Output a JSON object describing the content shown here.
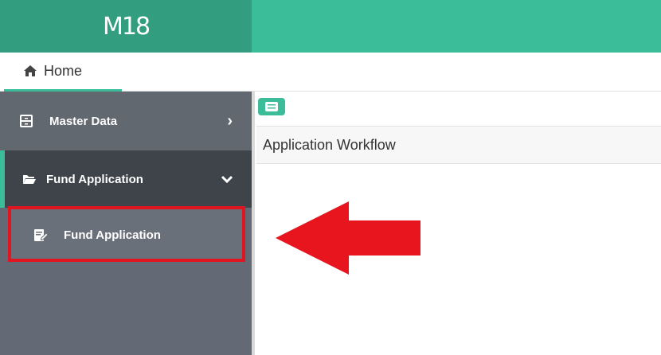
{
  "header": {
    "logo_text": "M18"
  },
  "tabs": {
    "home_label": "Home"
  },
  "sidebar": {
    "items": [
      {
        "label": "Master Data",
        "icon": "archive-icon",
        "state": "collapsed"
      },
      {
        "label": "Fund Application",
        "icon": "folder-open-icon",
        "state": "expanded"
      },
      {
        "label": "Fund Application",
        "icon": "edit-document-icon",
        "state": "highlighted"
      }
    ]
  },
  "main": {
    "panel_title": "Application Workflow"
  },
  "colors": {
    "brand_green": "#3cbd99",
    "sidebar": "#636a75",
    "sidebar_active": "#3f444b",
    "highlight_red": "#e0151f"
  }
}
